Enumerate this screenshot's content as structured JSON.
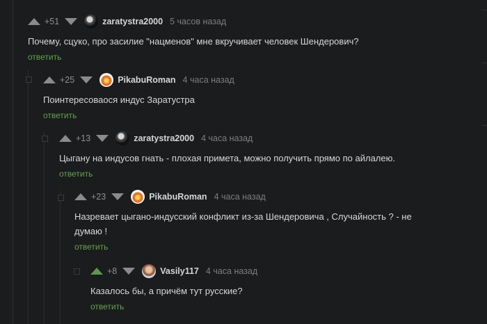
{
  "comments": [
    {
      "rating": "+51",
      "username": "zaratystra2000",
      "time": "5 часов назад",
      "text": "Почему, сцуко, про засилие \"нацменов\" мне вкручивает человек Шендерович?",
      "reply": "ответить"
    },
    {
      "rating": "+25",
      "username": "PikabuRoman",
      "time": "4 часа назад",
      "text": "Поинтересоваося индус Заратустра",
      "reply": "ответить"
    },
    {
      "rating": "+13",
      "username": "zaratystra2000",
      "time": "4 часа назад",
      "text": "Цыгану на индусов гнать - плохая примета, можно получить прямо по айлалею.",
      "reply": "ответить"
    },
    {
      "rating": "+23",
      "username": "PikabuRoman",
      "time": "4 часа назад",
      "text_line1": "Назревает цыгано-индусский конфликт из-за Шендеровича , Случайность ? - не",
      "text_line2": "думаю !",
      "reply": "ответить"
    },
    {
      "rating": "+8",
      "username": "Vasily117",
      "time": "4 часа назад",
      "text": "Казалось бы, а причём тут русские?",
      "reply": "ответить"
    }
  ],
  "colors": {
    "background": "#1b1c1e",
    "reply_green": "#61a349",
    "upvote_active": "#5a9b49"
  }
}
